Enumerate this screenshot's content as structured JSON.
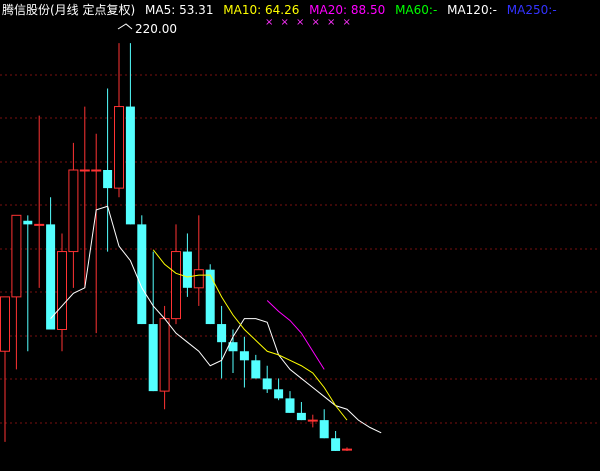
{
  "chart_data": {
    "type": "candlestick",
    "title": "腾信股份(月线 定点复权)",
    "indicators": [
      {
        "label": "MA5:",
        "value": "53.31",
        "color": "#ffffff"
      },
      {
        "label": "MA10:",
        "value": "64.26",
        "color": "#ffff00"
      },
      {
        "label": "MA20:",
        "value": "88.50",
        "color": "#ff00ff"
      },
      {
        "label": "MA60:",
        "value": "-",
        "color": "#00ff00"
      },
      {
        "label": "MA120:",
        "value": "-",
        "color": "#ffffff"
      },
      {
        "label": "MA250:",
        "value": "-",
        "color": "#3333ff"
      }
    ],
    "marker_symbol": "×",
    "marker_count": 6,
    "max_annotation": "220.00",
    "ylim": [
      0,
      230
    ],
    "grid": true,
    "up_color": "#ff3333",
    "down_color": "#54ffff",
    "candles": [
      {
        "o": 50,
        "h": 80,
        "l": 0,
        "c": 80
      },
      {
        "o": 80,
        "h": 125,
        "l": 40,
        "c": 125
      },
      {
        "o": 122,
        "h": 125,
        "l": 50,
        "c": 120
      },
      {
        "o": 120,
        "h": 180,
        "l": 85,
        "c": 120
      },
      {
        "o": 120,
        "h": 135,
        "l": 62,
        "c": 62
      },
      {
        "o": 62,
        "h": 115,
        "l": 50,
        "c": 105
      },
      {
        "o": 105,
        "h": 165,
        "l": 85,
        "c": 150
      },
      {
        "o": 150,
        "h": 185,
        "l": 85,
        "c": 150
      },
      {
        "o": 150,
        "h": 170,
        "l": 60,
        "c": 150
      },
      {
        "o": 150,
        "h": 195,
        "l": 105,
        "c": 140
      },
      {
        "o": 140,
        "h": 220,
        "l": 135,
        "c": 185
      },
      {
        "o": 185,
        "h": 220,
        "l": 120,
        "c": 120
      },
      {
        "o": 120,
        "h": 125,
        "l": 65,
        "c": 65
      },
      {
        "o": 65,
        "h": 105,
        "l": 28,
        "c": 28
      },
      {
        "o": 28,
        "h": 75,
        "l": 18,
        "c": 68
      },
      {
        "o": 68,
        "h": 120,
        "l": 65,
        "c": 105
      },
      {
        "o": 105,
        "h": 115,
        "l": 80,
        "c": 85
      },
      {
        "o": 85,
        "h": 125,
        "l": 75,
        "c": 95
      },
      {
        "o": 95,
        "h": 98,
        "l": 65,
        "c": 65
      },
      {
        "o": 65,
        "h": 75,
        "l": 35,
        "c": 55
      },
      {
        "o": 55,
        "h": 62,
        "l": 38,
        "c": 50
      },
      {
        "o": 50,
        "h": 58,
        "l": 30,
        "c": 45
      },
      {
        "o": 45,
        "h": 48,
        "l": 35,
        "c": 35
      },
      {
        "o": 35,
        "h": 42,
        "l": 27,
        "c": 29
      },
      {
        "o": 29,
        "h": 35,
        "l": 23,
        "c": 24
      },
      {
        "o": 24,
        "h": 28,
        "l": 16,
        "c": 16
      },
      {
        "o": 16,
        "h": 22,
        "l": 12,
        "c": 12
      },
      {
        "o": 12,
        "h": 15,
        "l": 8,
        "c": 12
      },
      {
        "o": 12,
        "h": 18,
        "l": 2,
        "c": 2
      },
      {
        "o": 2,
        "h": 6,
        "l": -5,
        "c": -5
      },
      {
        "o": -4,
        "h": -3,
        "l": -5,
        "c": -4
      }
    ],
    "series": [
      {
        "name": "MA5",
        "color": "#ffffff",
        "start": 4,
        "values": [
          68,
          75,
          82,
          85,
          128,
          130,
          108,
          100,
          85,
          75,
          68,
          60,
          55,
          50,
          42,
          45,
          58,
          68,
          68,
          66,
          48,
          40,
          35,
          30,
          25,
          20,
          18,
          12,
          8,
          5
        ]
      },
      {
        "name": "MA10",
        "color": "#ffff00",
        "start": 13,
        "values": [
          106,
          98,
          93,
          91,
          92,
          92,
          80,
          70,
          62,
          56,
          50,
          48,
          45,
          42,
          38,
          30,
          20,
          12
        ]
      },
      {
        "name": "MA20",
        "color": "#ff00ff",
        "start": 23,
        "values": [
          78,
          72,
          67,
          60,
          50,
          40
        ]
      }
    ]
  }
}
